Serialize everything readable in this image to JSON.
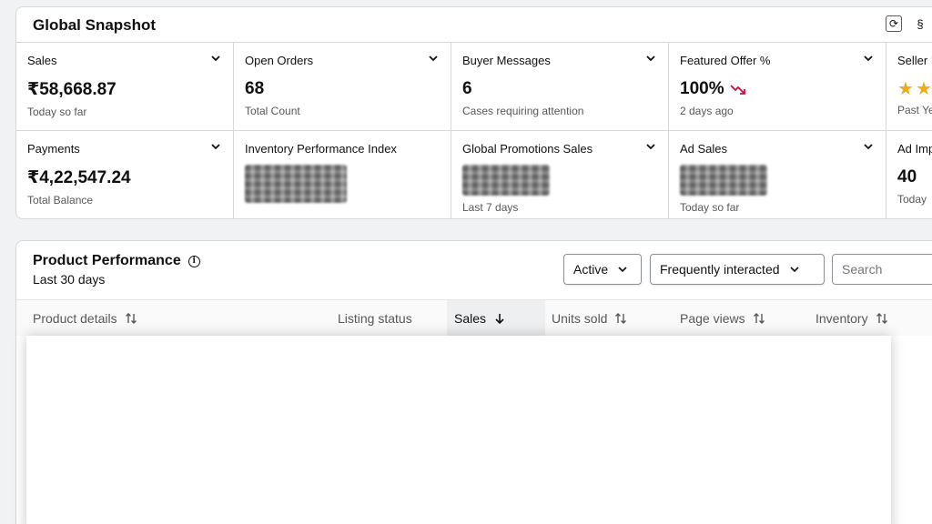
{
  "snapshot": {
    "title": "Global Snapshot",
    "tiles_row1": [
      {
        "label": "Sales",
        "value": "₹58,668.87",
        "sub": "Today so far",
        "chevron": true
      },
      {
        "label": "Open Orders",
        "value": "68",
        "sub": "Total Count",
        "chevron": true
      },
      {
        "label": "Buyer Messages",
        "value": "6",
        "sub": "Cases requiring attention",
        "chevron": true
      },
      {
        "label": "Featured Offer %",
        "value": "100%",
        "sub": "2 days ago",
        "chevron": true,
        "trend": "down"
      },
      {
        "label": "Seller F",
        "sub": "Past Ye",
        "stars": 2
      }
    ],
    "tiles_row2": [
      {
        "label": "Payments",
        "value": "₹4,22,547.24",
        "sub": "Total Balance",
        "chevron": true
      },
      {
        "label": "Inventory Performance Index",
        "sub": ""
      },
      {
        "label": "Global Promotions Sales",
        "sub": "Last 7 days",
        "chevron": true
      },
      {
        "label": "Ad Sales",
        "sub": "Today so far",
        "chevron": true
      },
      {
        "label": "Ad Imp",
        "value": "40",
        "sub": "Today"
      }
    ]
  },
  "performance": {
    "title": "Product Performance",
    "subtitle": "Last 30 days",
    "status_select": "Active",
    "sort_select": "Frequently interacted",
    "search_placeholder": "Search",
    "columns": [
      "Product details",
      "Listing status",
      "Sales",
      "Units sold",
      "Page views",
      "Inventory"
    ]
  },
  "colors": {
    "star": "#f2a91a",
    "trend_down": "#cc0c39",
    "border": "#d5d9d9"
  }
}
